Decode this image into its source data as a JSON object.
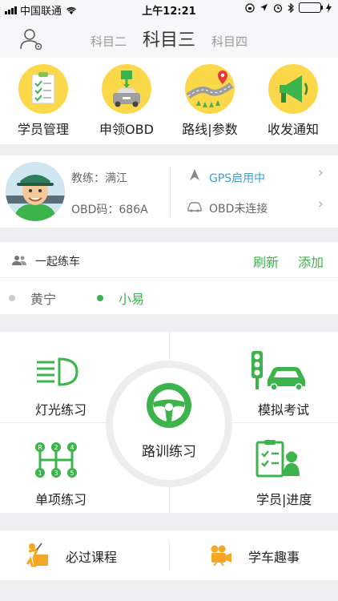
{
  "status_bar": {
    "carrier": "中国联通",
    "time": "上午12:21",
    "battery_color": "#2ecc40"
  },
  "nav": {
    "tabs": [
      {
        "label": "科目二",
        "active": false
      },
      {
        "label": "科目三",
        "active": true
      },
      {
        "label": "科目四",
        "active": false
      }
    ],
    "profile_icon": "user-settings-icon"
  },
  "quick_actions": [
    {
      "label": "学员管理",
      "icon": "clipboard-checklist-icon"
    },
    {
      "label": "申领OBD",
      "icon": "car-device-icon"
    },
    {
      "label": "路线|参数",
      "icon": "route-map-pin-icon"
    },
    {
      "label": "收发通知",
      "icon": "megaphone-icon"
    }
  ],
  "coach": {
    "name_line": "教练：满江",
    "obd_line": "OBD码：686A",
    "gps_status": "GPS启用中",
    "obd_status": "OBD未连接"
  },
  "practice_together": {
    "title": "一起练车",
    "refresh_label": "刷新",
    "add_label": "添加",
    "students": [
      {
        "name": "黄宁",
        "active": false
      },
      {
        "name": "小易",
        "active": true
      }
    ]
  },
  "modules": {
    "light": "灯光练习",
    "exam": "模拟考试",
    "single": "单项练习",
    "progress": "学员|进度",
    "road": "路训练习"
  },
  "bottom": {
    "course": "必过课程",
    "fun": "学车趣事"
  },
  "colors": {
    "accent_green": "#3cb44b",
    "gps_blue": "#3aa0d8",
    "icon_yellow": "#fbd84a",
    "icon_orange": "#f5a623"
  }
}
